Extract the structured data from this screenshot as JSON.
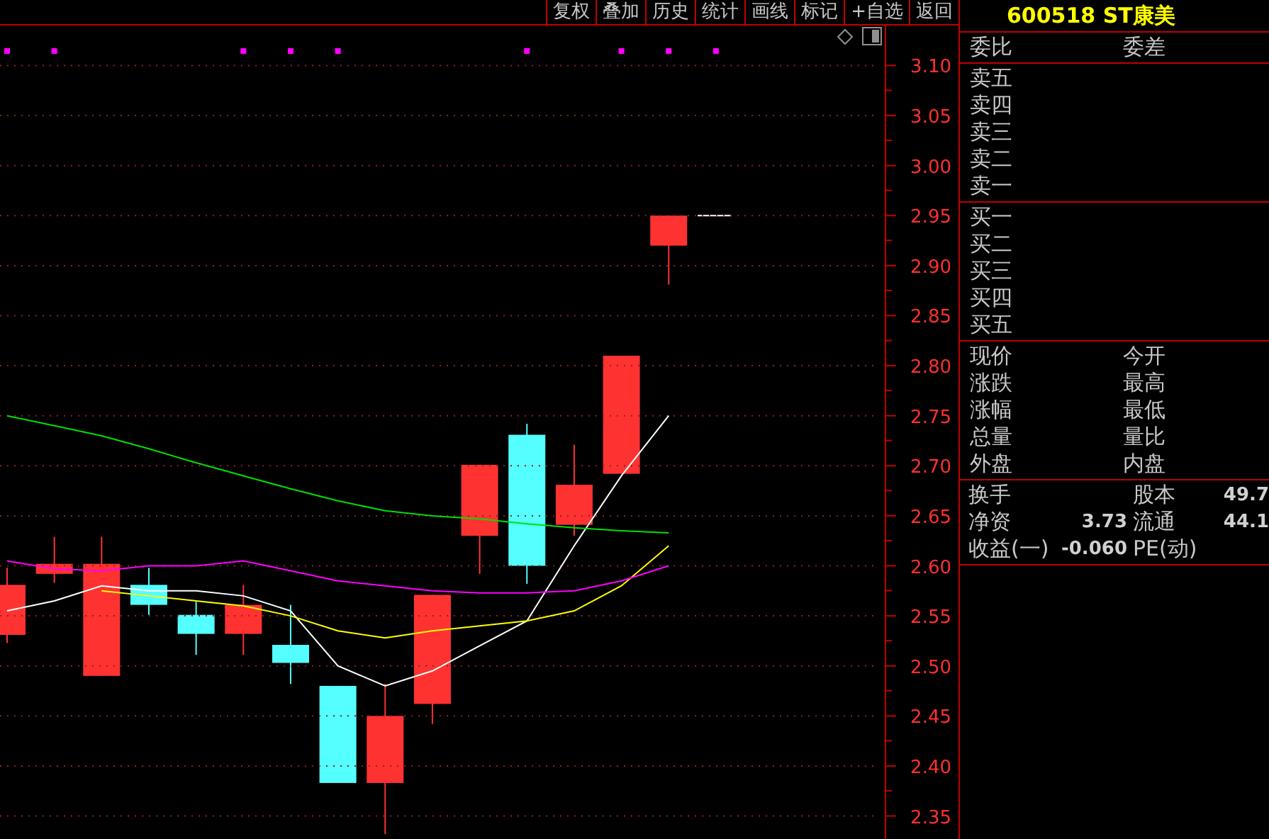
{
  "toolbar": {
    "buttons": [
      {
        "label": "复权"
      },
      {
        "label": "叠加"
      },
      {
        "label": "历史"
      },
      {
        "label": "统计"
      },
      {
        "label": "画线"
      },
      {
        "label": "标记"
      },
      {
        "label": "+自选"
      },
      {
        "label": "返回"
      }
    ]
  },
  "chart": {
    "chart_data": {
      "type": "line",
      "grid": true,
      "ylim": [
        2.327,
        3.14
      ],
      "yticks": [
        {
          "value": 3.1,
          "label": "3.10"
        },
        {
          "value": 3.05,
          "label": "3.05"
        },
        {
          "value": 3.0,
          "label": "3.00"
        },
        {
          "value": 2.95,
          "label": "2.95"
        },
        {
          "value": 2.9,
          "label": "2.90"
        },
        {
          "value": 2.85,
          "label": "2.85"
        },
        {
          "value": 2.8,
          "label": "2.80"
        },
        {
          "value": 2.75,
          "label": "2.75"
        },
        {
          "value": 2.7,
          "label": "2.70"
        },
        {
          "value": 2.65,
          "label": "2.65"
        },
        {
          "value": 2.6,
          "label": "2.60"
        },
        {
          "value": 2.55,
          "label": "2.55"
        },
        {
          "value": 2.5,
          "label": "2.50"
        },
        {
          "value": 2.45,
          "label": "2.45"
        },
        {
          "value": 2.4,
          "label": "2.40"
        },
        {
          "value": 2.35,
          "label": "2.35"
        }
      ],
      "series": [
        {
          "color": "#ffffff",
          "values": [
            2.555,
            2.565,
            2.58,
            2.575,
            2.575,
            2.57,
            2.555,
            2.5,
            2.48,
            2.495,
            2.52,
            2.545,
            2.62,
            2.69,
            2.75
          ]
        },
        {
          "color": "#ffff00",
          "values": [
            null,
            null,
            2.575,
            2.57,
            2.565,
            2.56,
            2.55,
            2.535,
            2.528,
            2.535,
            2.54,
            2.545,
            2.555,
            2.58,
            2.62
          ]
        },
        {
          "color": "#ff00ff",
          "values": [
            2.605,
            2.597,
            2.595,
            2.6,
            2.6,
            2.605,
            2.595,
            2.585,
            2.58,
            2.575,
            2.573,
            2.573,
            2.575,
            2.585,
            2.6
          ]
        },
        {
          "color": "#00e000",
          "values": [
            2.75,
            2.74,
            2.73,
            2.717,
            2.703,
            2.69,
            2.677,
            2.665,
            2.655,
            2.65,
            2.647,
            2.642,
            2.638,
            2.635,
            2.633
          ]
        }
      ]
    }
  },
  "quote": {
    "title": "600518 ST康美",
    "header": [
      {
        "label": "委比"
      },
      {
        "label": "委差"
      }
    ],
    "sell": [
      {
        "label": "卖五"
      },
      {
        "label": "卖四"
      },
      {
        "label": "卖三"
      },
      {
        "label": "卖二"
      },
      {
        "label": "卖一"
      }
    ],
    "buy": [
      {
        "label": "买一"
      },
      {
        "label": "买二"
      },
      {
        "label": "买三"
      },
      {
        "label": "买四"
      },
      {
        "label": "买五"
      }
    ],
    "stats": [
      {
        "label": "现价"
      },
      {
        "label": "今开"
      },
      {
        "label": "涨跌"
      },
      {
        "label": "最高"
      },
      {
        "label": "涨幅"
      },
      {
        "label": "最低"
      },
      {
        "label": "总量"
      },
      {
        "label": "量比"
      },
      {
        "label": "外盘"
      },
      {
        "label": "内盘"
      }
    ],
    "finance": [
      {
        "label": "换手"
      },
      {
        "label": "股本",
        "value": "49.7"
      },
      {
        "label": "净资",
        "value": "3.73"
      },
      {
        "label": "流通",
        "value": "44.1"
      },
      {
        "label": "收益(一)",
        "value": "-0.060"
      },
      {
        "label": "PE(动)"
      }
    ]
  }
}
